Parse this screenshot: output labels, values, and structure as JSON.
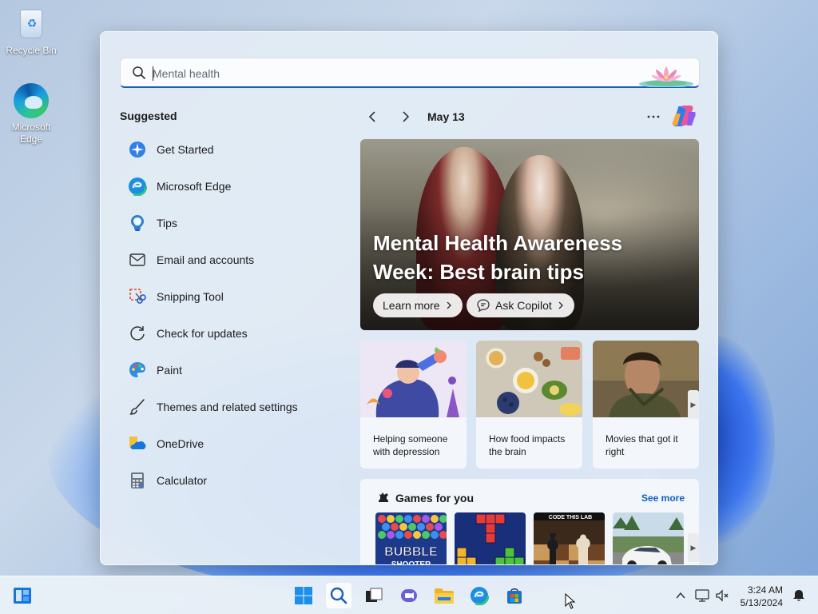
{
  "desktop": {
    "icons": [
      {
        "label": "Recycle Bin"
      },
      {
        "label": "Microsoft Edge"
      }
    ]
  },
  "start": {
    "search": {
      "value": "Mental health",
      "placeholder": "Mental health"
    },
    "suggested_title": "Suggested",
    "apps": [
      {
        "label": "Get Started",
        "icon": "get-started-icon"
      },
      {
        "label": "Microsoft Edge",
        "icon": "edge-icon"
      },
      {
        "label": "Tips",
        "icon": "tips-icon"
      },
      {
        "label": "Email and accounts",
        "icon": "mail-icon"
      },
      {
        "label": "Snipping Tool",
        "icon": "snipping-tool-icon"
      },
      {
        "label": "Check for updates",
        "icon": "refresh-icon"
      },
      {
        "label": "Paint",
        "icon": "paint-icon"
      },
      {
        "label": "Themes and related settings",
        "icon": "brush-icon"
      },
      {
        "label": "OneDrive",
        "icon": "onedrive-icon"
      },
      {
        "label": "Calculator",
        "icon": "calculator-icon"
      }
    ],
    "feed": {
      "date": "May 13",
      "hero": {
        "title": "Mental Health Awareness Week: Best brain tips",
        "learn_more": "Learn more",
        "ask_copilot": "Ask Copilot"
      },
      "cards": [
        {
          "caption": "Helping someone with depression"
        },
        {
          "caption": "How food impacts the brain"
        },
        {
          "caption": "Movies that got it right"
        }
      ],
      "games": {
        "title": "Games for you",
        "see_more": "See more",
        "items": [
          "BUBBLE SHOOTER",
          "Blocks",
          "CODE THIS LAB",
          "Racing"
        ]
      }
    }
  },
  "taskbar": {
    "time": "3:24 AM",
    "date": "5/13/2024"
  },
  "colors": {
    "accent": "#1a5fb4",
    "link": "#0f5fc2"
  }
}
